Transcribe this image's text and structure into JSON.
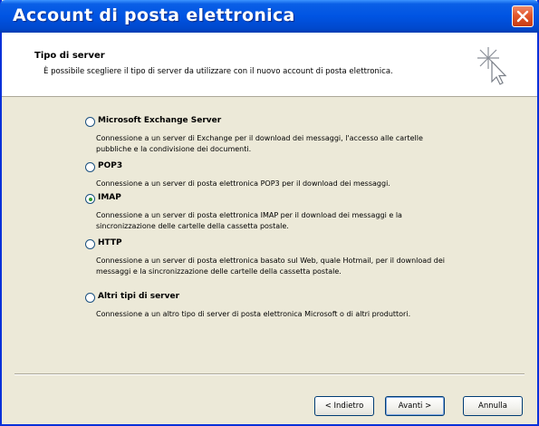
{
  "window": {
    "title": "Account di posta elettronica"
  },
  "header": {
    "title": "Tipo di server",
    "subtitle": "È possibile scegliere il tipo di server da utilizzare con il nuovo account di posta elettronica."
  },
  "options": [
    {
      "label": "Microsoft Exchange Server",
      "description": "Connessione a un server di Exchange per il download dei messaggi, l'accesso alle cartelle pubbliche e la condivisione dei documenti.",
      "checked": false
    },
    {
      "label": "POP3",
      "description": "Connessione a un server di posta elettronica POP3 per il download dei messaggi.",
      "checked": false
    },
    {
      "label": "IMAP",
      "description": "Connessione a un server di posta elettronica IMAP per il download dei messaggi e la sincronizzazione delle cartelle della cassetta postale.",
      "checked": true
    },
    {
      "label": "HTTP",
      "description": "Connessione a un server di posta elettronica basato sul Web, quale Hotmail, per il download dei messaggi e la sincronizzazione delle cartelle della cassetta postale.",
      "checked": false
    },
    {
      "label": "Altri tipi di server",
      "description": "Connessione a un altro tipo di server di posta elettronica Microsoft o di altri produttori.",
      "checked": false
    }
  ],
  "buttons": {
    "back": "< Indietro",
    "next": "Avanti >",
    "cancel": "Annulla"
  },
  "colors": {
    "titlebar": "#0054e3",
    "dialog_bg": "#ece9d8",
    "close": "#e2572c",
    "radio_checked": "#2f9a2f"
  },
  "icons": {
    "close": "close-icon",
    "wizard": "wizard-sparkle-cursor-icon"
  }
}
